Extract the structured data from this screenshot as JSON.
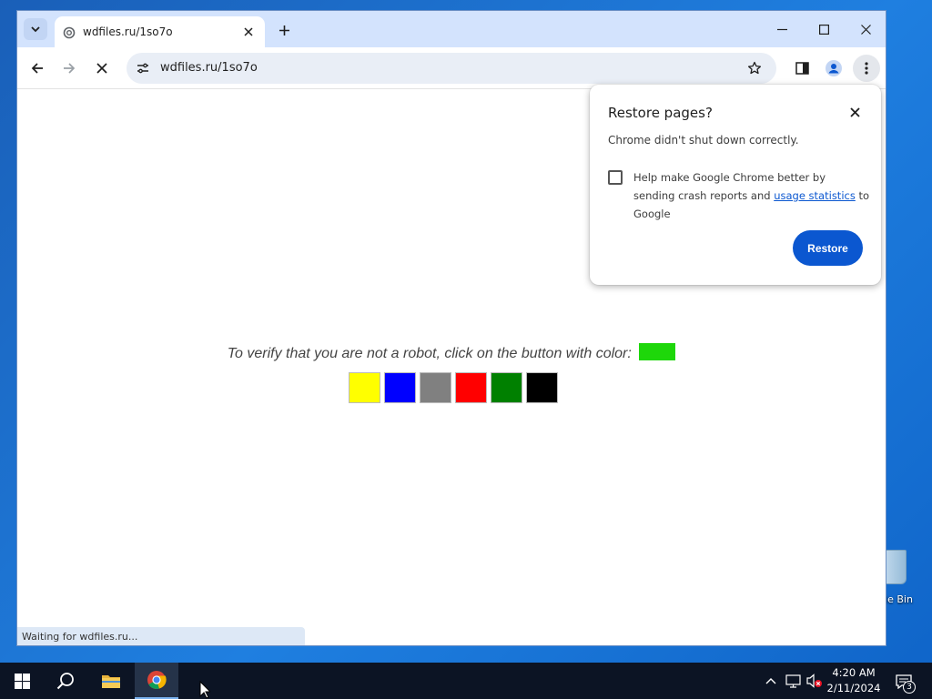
{
  "browser": {
    "tab": {
      "title": "wdfiles.ru/1so7o"
    },
    "address_bar": {
      "url": "wdfiles.ru/1so7o"
    },
    "status_text": "Waiting for wdfiles.ru..."
  },
  "page": {
    "prompt": "To verify that you are not a robot, click on the button with color:",
    "target_color": "#1ed70a",
    "color_buttons": [
      {
        "name": "yellow",
        "color": "#ffff00"
      },
      {
        "name": "blue",
        "color": "#0000ff"
      },
      {
        "name": "gray",
        "color": "#808080"
      },
      {
        "name": "red",
        "color": "#ff0000"
      },
      {
        "name": "green",
        "color": "#008000"
      },
      {
        "name": "black",
        "color": "#000000"
      }
    ]
  },
  "dialog": {
    "title": "Restore pages?",
    "message": "Chrome didn't shut down correctly.",
    "checkbox_text_before": "Help make Google Chrome better by sending crash reports and ",
    "checkbox_link": "usage statistics",
    "checkbox_text_after": " to Google",
    "checkbox_checked": false,
    "restore_button": "Restore"
  },
  "desktop": {
    "recycle_bin_label": "cle Bin"
  },
  "taskbar": {
    "time": "4:20 AM",
    "date": "2/11/2024",
    "notification_count": "3"
  },
  "colors": {
    "accent": "#0b57d0",
    "tab_strip": "#d3e3fd"
  }
}
